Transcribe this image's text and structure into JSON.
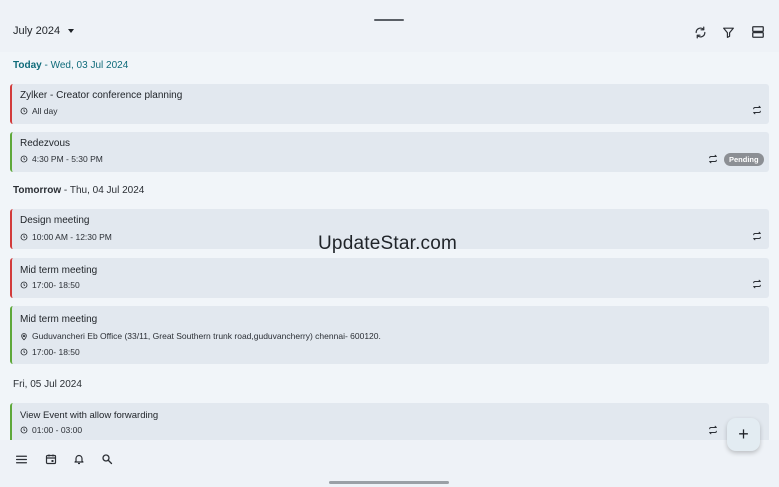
{
  "header": {
    "month_label": "July 2024",
    "icons": [
      "sync-icon",
      "filter-icon",
      "view-toggle-icon"
    ]
  },
  "days": [
    {
      "label": "Today",
      "date": " - Wed, 03 Jul 2024",
      "events": [
        {
          "title": "Zylker - Creator conference planning",
          "time": "All day",
          "color": "#d23b3b",
          "repeat": true
        },
        {
          "title": "Redezvous",
          "time": "4:30 PM - 5:30 PM",
          "color": "#5ea83a",
          "repeat": true,
          "badge": "Pending"
        }
      ]
    },
    {
      "label": "Tomorrow",
      "date": " - Thu, 04 Jul 2024",
      "events": [
        {
          "title": "Design meeting",
          "time": "10:00 AM - 12:30 PM",
          "color": "#d23b3b",
          "repeat": true
        },
        {
          "title": "Mid term meeting",
          "time": "17:00- 18:50",
          "color": "#d23b3b",
          "repeat": true
        },
        {
          "title": "Mid term meeting",
          "location": "Guduvancheri Eb Office (33/11, Great Southern trunk road,guduvancherry)  chennai- 600120.",
          "time": "17:00- 18:50",
          "color": "#5ea83a"
        }
      ]
    },
    {
      "label": "Fri, 05 Jul 2024",
      "date": "",
      "events": [
        {
          "title": "View Event with allow forwarding",
          "time": "01:00 - 03:00",
          "color": "#5ea83a",
          "repeat": true
        }
      ]
    }
  ],
  "watermark": "UpdateStar.com",
  "bottom_nav": [
    "menu-icon",
    "calendar-icon",
    "bell-icon",
    "search-icon"
  ],
  "fab_label": "+"
}
